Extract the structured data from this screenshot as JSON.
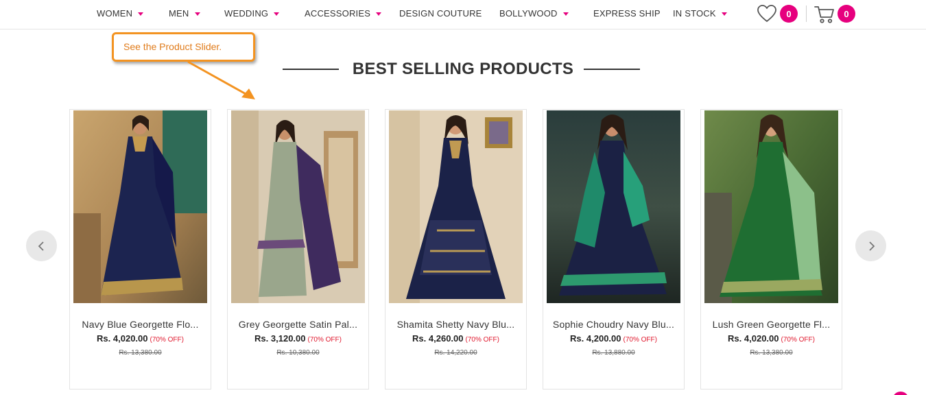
{
  "nav": {
    "items": [
      {
        "label": "WOMEN",
        "dropdown": true
      },
      {
        "label": "MEN",
        "dropdown": true
      },
      {
        "label": "WEDDING",
        "dropdown": true
      },
      {
        "label": "ACCESSORIES",
        "dropdown": true
      },
      {
        "label": "DESIGN COUTURE",
        "dropdown": false
      },
      {
        "label": "BOLLYWOOD",
        "dropdown": true
      },
      {
        "label": "EXPRESS SHIP",
        "dropdown": false
      },
      {
        "label": "IN STOCK",
        "dropdown": true
      }
    ],
    "wishlist_icon": "heart-icon",
    "wishlist_count": "0",
    "cart_icon": "cart-icon",
    "cart_count": "0"
  },
  "callout": {
    "text": "See the Product Slider."
  },
  "section": {
    "title": "BEST SELLING PRODUCTS"
  },
  "slider": {
    "prev_icon": "chevron-left-icon",
    "next_icon": "chevron-right-icon"
  },
  "products": [
    {
      "name": "Navy Blue Georgette Flo...",
      "price": "Rs. 4,020.00",
      "discount": "(70% OFF)",
      "mrp": "Rs. 13,380.00"
    },
    {
      "name": "Grey Georgette Satin Pal...",
      "price": "Rs. 3,120.00",
      "discount": "(70% OFF)",
      "mrp": "Rs. 10,380.00"
    },
    {
      "name": "Shamita Shetty Navy Blu...",
      "price": "Rs. 4,260.00",
      "discount": "(70% OFF)",
      "mrp": "Rs. 14,220.00"
    },
    {
      "name": "Sophie Choudry Navy Blu...",
      "price": "Rs. 4,200.00",
      "discount": "(70% OFF)",
      "mrp": "Rs. 13,880.00"
    },
    {
      "name": "Lush Green Georgette Fl...",
      "price": "Rs. 4,020.00",
      "discount": "(70% OFF)",
      "mrp": "Rs. 13,380.00"
    }
  ],
  "colors": {
    "accent": "#e6007e",
    "callout": "#f39321",
    "discount": "#e0192e"
  }
}
